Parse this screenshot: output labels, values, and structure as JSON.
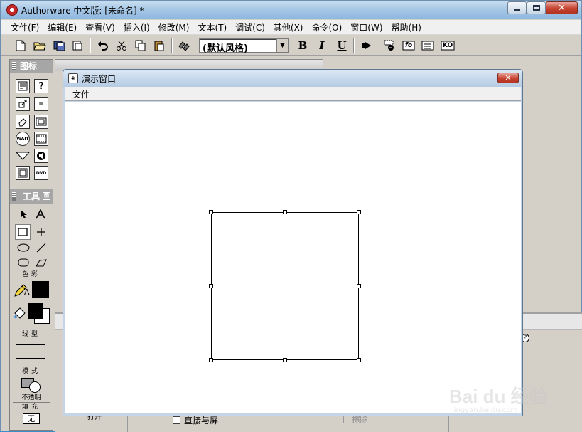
{
  "window": {
    "title": "Authorware 中文版: [未命名] *"
  },
  "menu": {
    "items": [
      "文件(F)",
      "编辑(E)",
      "查看(V)",
      "插入(I)",
      "修改(M)",
      "文本(T)",
      "调试(C)",
      "其他(X)",
      "命令(O)",
      "窗口(W)",
      "帮助(H)"
    ]
  },
  "toolbar": {
    "style_value": "(默认风格)",
    "bold_label": "B",
    "italic_label": "I",
    "underline_label": "U",
    "ko_label": "KO",
    "fo_label": "fo"
  },
  "icon_palette": {
    "title": "图标",
    "wait_label": "WAIT",
    "dvd_label": "DVD"
  },
  "tools_palette": {
    "title": "工具",
    "close_label": "⊠",
    "color_section": "色彩",
    "line_section": "线型",
    "mode_section": "模式",
    "mode_value": "不透明",
    "fill_section": "填充",
    "fill_value": "无"
  },
  "presentation_window": {
    "title": "演示窗口",
    "menu_file": "文件"
  },
  "background_panel": {
    "open_button": "打开",
    "direct_to_screen": "直接与屏",
    "erase_button": "擦除",
    "help_glyph": "?"
  },
  "watermark": {
    "text": "Bai du 经验",
    "sub": "jingyan.baidu.com"
  },
  "colors": {
    "title_bar": "#a8c8e6",
    "close_button": "#c5432f",
    "stage": "#ffffff"
  }
}
